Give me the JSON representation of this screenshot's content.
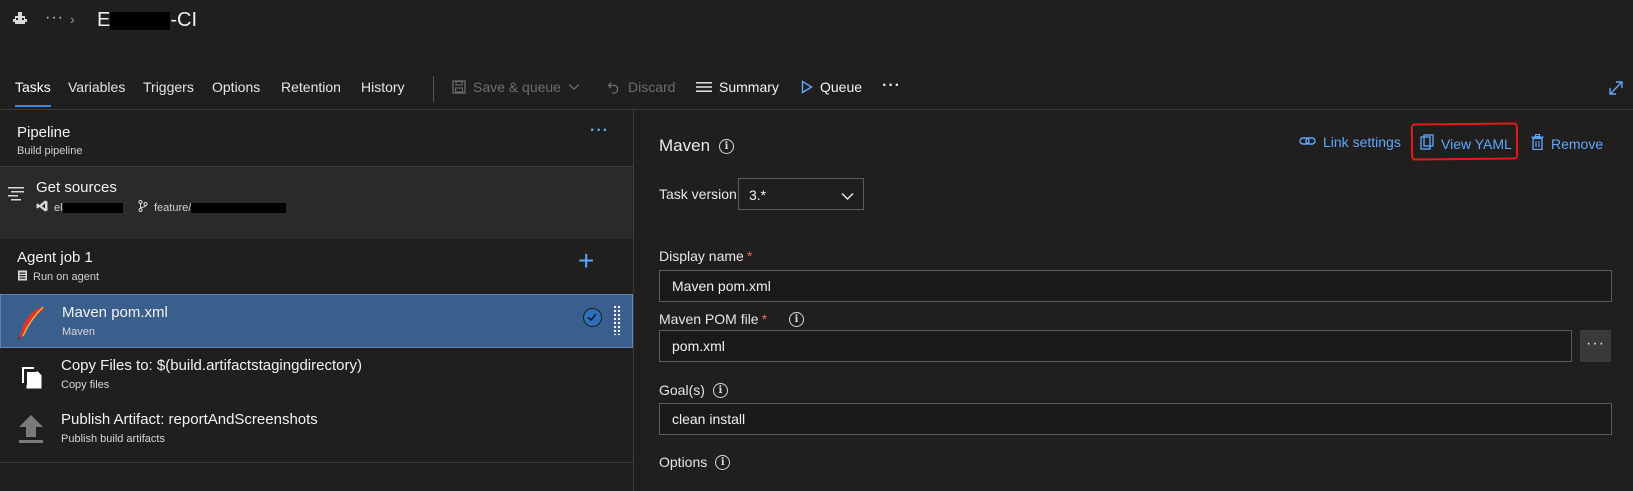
{
  "header": {
    "title_prefix": "E",
    "title_suffix": "-CI",
    "more_label": "···",
    "breadcrumb_chevron": "›"
  },
  "tabs": [
    {
      "label": "Tasks",
      "active": true
    },
    {
      "label": "Variables"
    },
    {
      "label": "Triggers"
    },
    {
      "label": "Options"
    },
    {
      "label": "Retention"
    },
    {
      "label": "History"
    }
  ],
  "toolbar": {
    "save_queue": "Save & queue",
    "discard": "Discard",
    "summary": "Summary",
    "queue": "Queue",
    "more": "···"
  },
  "pipeline": {
    "title": "Pipeline",
    "subtitle": "Build pipeline",
    "more": "···"
  },
  "sources": {
    "title": "Get sources",
    "repo_prefix": "el",
    "branch_prefix": "feature/"
  },
  "agent_job": {
    "title": "Agent job 1",
    "subtitle": "Run on agent",
    "add": "+"
  },
  "tasks": [
    {
      "title": "Maven pom.xml",
      "subtitle": "Maven",
      "selected": true
    },
    {
      "title": "Copy Files to: $(build.artifactstagingdirectory)",
      "subtitle": "Copy files"
    },
    {
      "title": "Publish Artifact: reportAndScreenshots",
      "subtitle": "Publish build artifacts"
    }
  ],
  "detail": {
    "title": "Maven",
    "link_settings": "Link settings",
    "view_yaml": "View YAML",
    "remove": "Remove",
    "task_version_label": "Task version",
    "task_version_value": "3.*",
    "display_name_label": "Display name",
    "display_name_value": "Maven pom.xml",
    "pom_file_label": "Maven POM file",
    "pom_file_value": "pom.xml",
    "goals_label": "Goal(s)",
    "goals_value": "clean install",
    "options_label": "Options",
    "required_mark": "*",
    "browse": "···"
  },
  "colors": {
    "background": "#201f1e",
    "accent": "#5ea8ff",
    "selected_row": "#3b5f8c",
    "annotation_red": "#e11b1b"
  }
}
